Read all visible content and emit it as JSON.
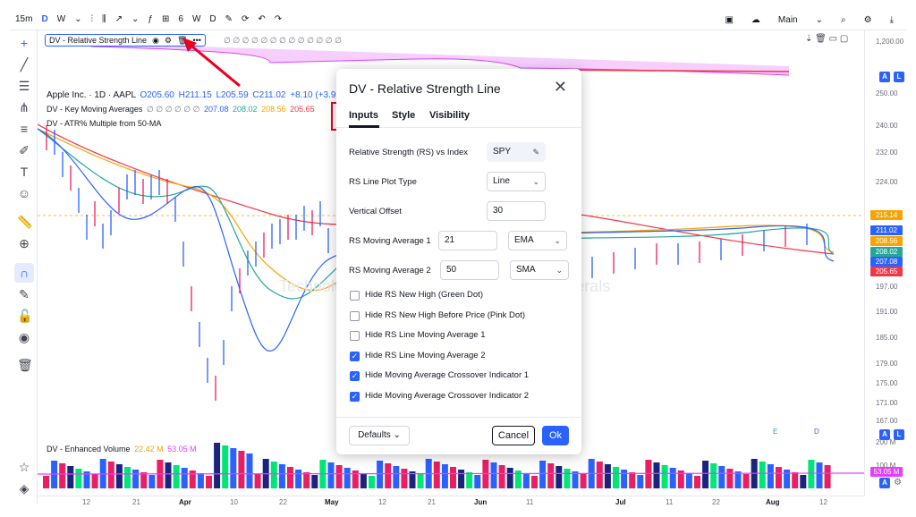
{
  "toolbar": {
    "interval": "15m",
    "intervals": [
      "D",
      "W",
      "6",
      "W",
      "D"
    ],
    "layout_name": "Main"
  },
  "rs_legend": {
    "name": "DV - Relative Strength Line",
    "values": "∅ ∅ ∅ ∅ ∅ ∅ ∅ ∅ ∅ ∅ ∅ ∅ ∅"
  },
  "main_legend": {
    "symbol": "Apple Inc. · 1D · AAPL",
    "o": "O205.60",
    "h": "H211.15",
    "l": "L205.59",
    "c": "C211.02",
    "chg": "+8.10 (+3.99%)"
  },
  "kma_legend": {
    "name": "DV - Key Moving Averages",
    "placeholders": "∅ ∅ ∅ ∅ ∅ ∅",
    "v1": "207.08",
    "v2": "208.02",
    "v3": "208.56",
    "v4": "205.65"
  },
  "atr_legend": {
    "name": "DV - ATR% Multiple from 50-MA"
  },
  "volume_legend": {
    "name": "DV - Enhanced Volume",
    "v1": "22.42 M",
    "v2": "53.05 M"
  },
  "watermark": "Technology · Computers, Phone & Peripherals",
  "y_axis": {
    "top_label": "1,200.00",
    "ticks": [
      "250.00",
      "240.00",
      "232.00",
      "224.00",
      "197.00",
      "191.00",
      "185.00",
      "179.00",
      "175.00",
      "171.00",
      "167.00",
      "200 M",
      "100 M"
    ],
    "price_boxes": [
      {
        "label": "215.14",
        "color": "#f7a400"
      },
      {
        "label": "211.02",
        "color": "#2962ff"
      },
      {
        "label": "208.56",
        "color": "#f7a400"
      },
      {
        "label": "208.02",
        "color": "#26a69a"
      },
      {
        "label": "207.08",
        "color": "#2962ff"
      },
      {
        "label": "205.65",
        "color": "#f23645"
      },
      {
        "label": "53.05 M",
        "color": "#e040fb"
      }
    ]
  },
  "x_axis": {
    "ticks": [
      "12",
      "21",
      "Apr",
      "10",
      "22",
      "May",
      "12",
      "21",
      "Jun",
      "11",
      "Jul",
      "11",
      "22",
      "Aug",
      "12"
    ]
  },
  "markers": {
    "e": "E",
    "d": "D"
  },
  "dialog": {
    "title": "DV - Relative Strength Line",
    "tabs": [
      "Inputs",
      "Style",
      "Visibility"
    ],
    "rs_vs_index_label": "Relative Strength (RS) vs Index",
    "rs_vs_index_value": "SPY",
    "plot_type_label": "RS Line Plot Type",
    "plot_type_value": "Line",
    "vertical_offset_label": "Vertical Offset",
    "vertical_offset_value": "30",
    "ma1_label": "RS Moving Average 1",
    "ma1_length": "21",
    "ma1_type": "EMA",
    "ma2_label": "RS Moving Average 2",
    "ma2_length": "50",
    "ma2_type": "SMA",
    "checkboxes": [
      {
        "label": "Hide RS New High (Green Dot)",
        "checked": false
      },
      {
        "label": "Hide RS New High Before Price (Pink Dot)",
        "checked": false
      },
      {
        "label": "Hide RS Line Moving Average 1",
        "checked": false
      },
      {
        "label": "Hide RS Line Moving Average 2",
        "checked": true
      },
      {
        "label": "Hide Moving Average Crossover Indicator 1",
        "checked": true
      },
      {
        "label": "Hide Moving Average Crossover Indicator 2",
        "checked": true
      }
    ],
    "defaults_label": "Defaults",
    "cancel_label": "Cancel",
    "ok_label": "Ok"
  },
  "chart_data": {
    "type": "candlestick",
    "x_range": [
      "Mar",
      "Aug"
    ],
    "ylim": [
      167,
      250
    ],
    "colors": {
      "up": "#2962ff",
      "down": "#e91e63",
      "ma_orange": "#f7a400",
      "ma_teal": "#26a69a",
      "ma_blue": "#2962ff",
      "ma_red": "#f23645",
      "rs_fill": "#e040fb"
    }
  }
}
